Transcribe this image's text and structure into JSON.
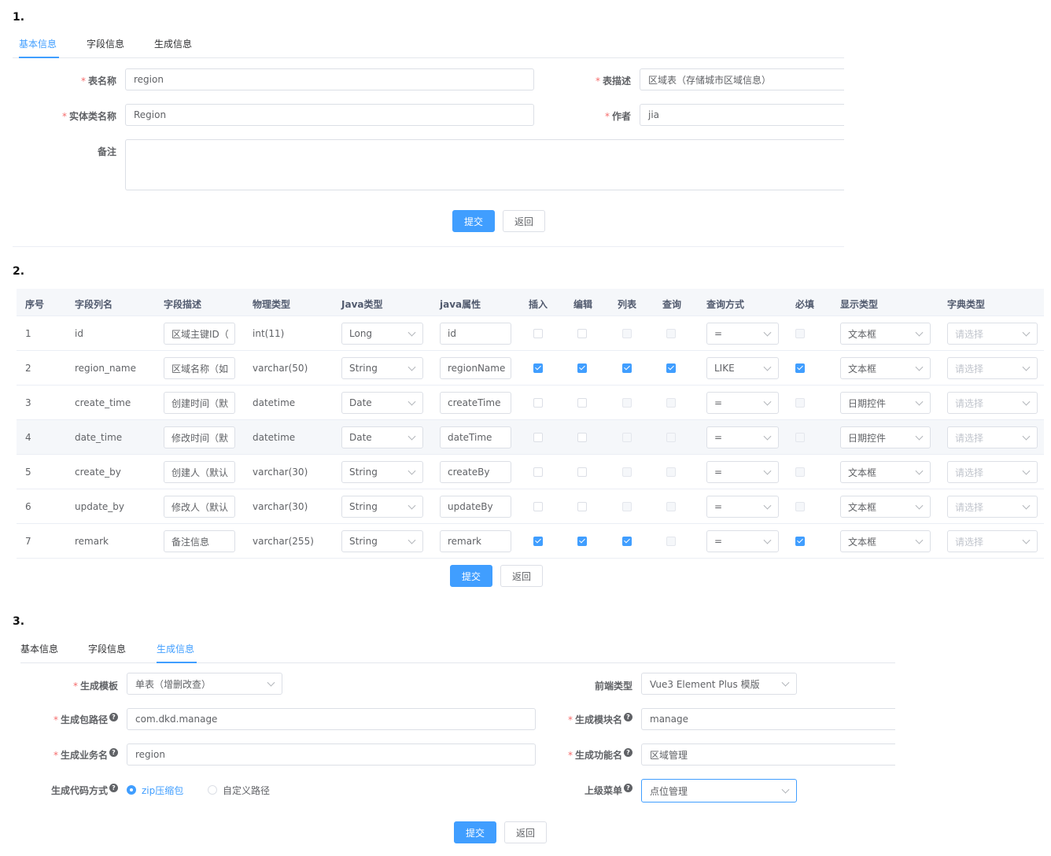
{
  "sections": {
    "one": "1.",
    "two": "2.",
    "three": "3."
  },
  "tabs": [
    "基本信息",
    "字段信息",
    "生成信息"
  ],
  "basic": {
    "table_name_label": "表名称",
    "table_name": "region",
    "table_desc_label": "表描述",
    "table_desc": "区域表（存储城市区域信息）",
    "class_name_label": "实体类名称",
    "class_name": "Region",
    "author_label": "作者",
    "author": "jia",
    "remark_label": "备注",
    "remark": ""
  },
  "buttons": {
    "submit": "提交",
    "back": "返回"
  },
  "columns": {
    "headers": [
      "序号",
      "字段列名",
      "字段描述",
      "物理类型",
      "Java类型",
      "java属性",
      "插入",
      "编辑",
      "列表",
      "查询",
      "查询方式",
      "必填",
      "显示类型",
      "字典类型"
    ],
    "dict_placeholder": "请选择",
    "rows": [
      {
        "no": "1",
        "column": "id",
        "desc": "区域主键ID（",
        "phys": "int(11)",
        "java_type": "Long",
        "java_field": "id",
        "insert": false,
        "edit": false,
        "list": false,
        "query": false,
        "query_type": "=",
        "required": false,
        "html_type": "文本框"
      },
      {
        "no": "2",
        "column": "region_name",
        "desc": "区域名称（如",
        "phys": "varchar(50)",
        "java_type": "String",
        "java_field": "regionName",
        "insert": true,
        "edit": true,
        "list": true,
        "query": true,
        "query_type": "LIKE",
        "required": true,
        "html_type": "文本框"
      },
      {
        "no": "3",
        "column": "create_time",
        "desc": "创建时间（默",
        "phys": "datetime",
        "java_type": "Date",
        "java_field": "createTime",
        "insert": false,
        "edit": false,
        "list": false,
        "query": false,
        "query_type": "=",
        "required": false,
        "html_type": "日期控件"
      },
      {
        "no": "4",
        "column": "date_time",
        "desc": "修改时间（默",
        "phys": "datetime",
        "java_type": "Date",
        "java_field": "dateTime",
        "insert": false,
        "edit": false,
        "list": false,
        "query": false,
        "query_type": "=",
        "required": false,
        "html_type": "日期控件"
      },
      {
        "no": "5",
        "column": "create_by",
        "desc": "创建人（默认",
        "phys": "varchar(30)",
        "java_type": "String",
        "java_field": "createBy",
        "insert": false,
        "edit": false,
        "list": false,
        "query": false,
        "query_type": "=",
        "required": false,
        "html_type": "文本框"
      },
      {
        "no": "6",
        "column": "update_by",
        "desc": "修改人（默认",
        "phys": "varchar(30)",
        "java_type": "String",
        "java_field": "updateBy",
        "insert": false,
        "edit": false,
        "list": false,
        "query": false,
        "query_type": "=",
        "required": false,
        "html_type": "文本框"
      },
      {
        "no": "7",
        "column": "remark",
        "desc": "备注信息",
        "phys": "varchar(255)",
        "java_type": "String",
        "java_field": "remark",
        "insert": true,
        "edit": true,
        "list": true,
        "query": false,
        "query_type": "=",
        "required": true,
        "html_type": "文本框"
      }
    ]
  },
  "gen": {
    "template_label": "生成模板",
    "template": "单表（增删改查）",
    "front_label": "前端类型",
    "front": "Vue3 Element Plus 模版",
    "package_label": "生成包路径",
    "package": "com.dkd.manage",
    "module_label": "生成模块名",
    "module": "manage",
    "business_label": "生成业务名",
    "business": "region",
    "function_label": "生成功能名",
    "function": "区域管理",
    "gen_type_label": "生成代码方式",
    "gen_type_zip": "zip压缩包",
    "gen_type_path": "自定义路径",
    "parent_menu_label": "上级菜单",
    "parent_menu": "点位管理"
  },
  "colors": {
    "primary": "#409eff",
    "required": "#f56c6c",
    "border": "#dcdfe6"
  }
}
